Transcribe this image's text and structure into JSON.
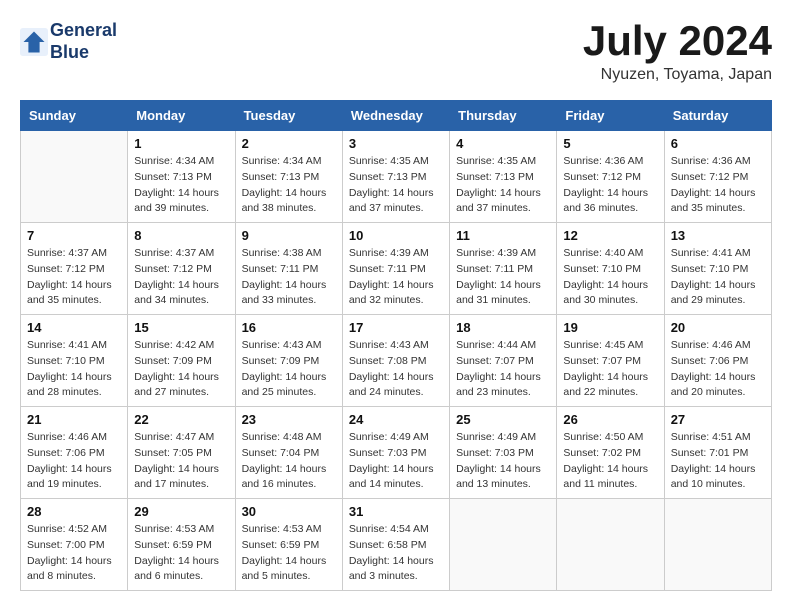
{
  "header": {
    "logo_line1": "General",
    "logo_line2": "Blue",
    "title": "July 2024",
    "location": "Nyuzen, Toyama, Japan"
  },
  "days_of_week": [
    "Sunday",
    "Monday",
    "Tuesday",
    "Wednesday",
    "Thursday",
    "Friday",
    "Saturday"
  ],
  "weeks": [
    [
      {
        "day": "",
        "sunrise": "",
        "sunset": "",
        "daylight": ""
      },
      {
        "day": "1",
        "sunrise": "Sunrise: 4:34 AM",
        "sunset": "Sunset: 7:13 PM",
        "daylight": "Daylight: 14 hours and 39 minutes."
      },
      {
        "day": "2",
        "sunrise": "Sunrise: 4:34 AM",
        "sunset": "Sunset: 7:13 PM",
        "daylight": "Daylight: 14 hours and 38 minutes."
      },
      {
        "day": "3",
        "sunrise": "Sunrise: 4:35 AM",
        "sunset": "Sunset: 7:13 PM",
        "daylight": "Daylight: 14 hours and 37 minutes."
      },
      {
        "day": "4",
        "sunrise": "Sunrise: 4:35 AM",
        "sunset": "Sunset: 7:13 PM",
        "daylight": "Daylight: 14 hours and 37 minutes."
      },
      {
        "day": "5",
        "sunrise": "Sunrise: 4:36 AM",
        "sunset": "Sunset: 7:12 PM",
        "daylight": "Daylight: 14 hours and 36 minutes."
      },
      {
        "day": "6",
        "sunrise": "Sunrise: 4:36 AM",
        "sunset": "Sunset: 7:12 PM",
        "daylight": "Daylight: 14 hours and 35 minutes."
      }
    ],
    [
      {
        "day": "7",
        "sunrise": "Sunrise: 4:37 AM",
        "sunset": "Sunset: 7:12 PM",
        "daylight": "Daylight: 14 hours and 35 minutes."
      },
      {
        "day": "8",
        "sunrise": "Sunrise: 4:37 AM",
        "sunset": "Sunset: 7:12 PM",
        "daylight": "Daylight: 14 hours and 34 minutes."
      },
      {
        "day": "9",
        "sunrise": "Sunrise: 4:38 AM",
        "sunset": "Sunset: 7:11 PM",
        "daylight": "Daylight: 14 hours and 33 minutes."
      },
      {
        "day": "10",
        "sunrise": "Sunrise: 4:39 AM",
        "sunset": "Sunset: 7:11 PM",
        "daylight": "Daylight: 14 hours and 32 minutes."
      },
      {
        "day": "11",
        "sunrise": "Sunrise: 4:39 AM",
        "sunset": "Sunset: 7:11 PM",
        "daylight": "Daylight: 14 hours and 31 minutes."
      },
      {
        "day": "12",
        "sunrise": "Sunrise: 4:40 AM",
        "sunset": "Sunset: 7:10 PM",
        "daylight": "Daylight: 14 hours and 30 minutes."
      },
      {
        "day": "13",
        "sunrise": "Sunrise: 4:41 AM",
        "sunset": "Sunset: 7:10 PM",
        "daylight": "Daylight: 14 hours and 29 minutes."
      }
    ],
    [
      {
        "day": "14",
        "sunrise": "Sunrise: 4:41 AM",
        "sunset": "Sunset: 7:10 PM",
        "daylight": "Daylight: 14 hours and 28 minutes."
      },
      {
        "day": "15",
        "sunrise": "Sunrise: 4:42 AM",
        "sunset": "Sunset: 7:09 PM",
        "daylight": "Daylight: 14 hours and 27 minutes."
      },
      {
        "day": "16",
        "sunrise": "Sunrise: 4:43 AM",
        "sunset": "Sunset: 7:09 PM",
        "daylight": "Daylight: 14 hours and 25 minutes."
      },
      {
        "day": "17",
        "sunrise": "Sunrise: 4:43 AM",
        "sunset": "Sunset: 7:08 PM",
        "daylight": "Daylight: 14 hours and 24 minutes."
      },
      {
        "day": "18",
        "sunrise": "Sunrise: 4:44 AM",
        "sunset": "Sunset: 7:07 PM",
        "daylight": "Daylight: 14 hours and 23 minutes."
      },
      {
        "day": "19",
        "sunrise": "Sunrise: 4:45 AM",
        "sunset": "Sunset: 7:07 PM",
        "daylight": "Daylight: 14 hours and 22 minutes."
      },
      {
        "day": "20",
        "sunrise": "Sunrise: 4:46 AM",
        "sunset": "Sunset: 7:06 PM",
        "daylight": "Daylight: 14 hours and 20 minutes."
      }
    ],
    [
      {
        "day": "21",
        "sunrise": "Sunrise: 4:46 AM",
        "sunset": "Sunset: 7:06 PM",
        "daylight": "Daylight: 14 hours and 19 minutes."
      },
      {
        "day": "22",
        "sunrise": "Sunrise: 4:47 AM",
        "sunset": "Sunset: 7:05 PM",
        "daylight": "Daylight: 14 hours and 17 minutes."
      },
      {
        "day": "23",
        "sunrise": "Sunrise: 4:48 AM",
        "sunset": "Sunset: 7:04 PM",
        "daylight": "Daylight: 14 hours and 16 minutes."
      },
      {
        "day": "24",
        "sunrise": "Sunrise: 4:49 AM",
        "sunset": "Sunset: 7:03 PM",
        "daylight": "Daylight: 14 hours and 14 minutes."
      },
      {
        "day": "25",
        "sunrise": "Sunrise: 4:49 AM",
        "sunset": "Sunset: 7:03 PM",
        "daylight": "Daylight: 14 hours and 13 minutes."
      },
      {
        "day": "26",
        "sunrise": "Sunrise: 4:50 AM",
        "sunset": "Sunset: 7:02 PM",
        "daylight": "Daylight: 14 hours and 11 minutes."
      },
      {
        "day": "27",
        "sunrise": "Sunrise: 4:51 AM",
        "sunset": "Sunset: 7:01 PM",
        "daylight": "Daylight: 14 hours and 10 minutes."
      }
    ],
    [
      {
        "day": "28",
        "sunrise": "Sunrise: 4:52 AM",
        "sunset": "Sunset: 7:00 PM",
        "daylight": "Daylight: 14 hours and 8 minutes."
      },
      {
        "day": "29",
        "sunrise": "Sunrise: 4:53 AM",
        "sunset": "Sunset: 6:59 PM",
        "daylight": "Daylight: 14 hours and 6 minutes."
      },
      {
        "day": "30",
        "sunrise": "Sunrise: 4:53 AM",
        "sunset": "Sunset: 6:59 PM",
        "daylight": "Daylight: 14 hours and 5 minutes."
      },
      {
        "day": "31",
        "sunrise": "Sunrise: 4:54 AM",
        "sunset": "Sunset: 6:58 PM",
        "daylight": "Daylight: 14 hours and 3 minutes."
      },
      {
        "day": "",
        "sunrise": "",
        "sunset": "",
        "daylight": ""
      },
      {
        "day": "",
        "sunrise": "",
        "sunset": "",
        "daylight": ""
      },
      {
        "day": "",
        "sunrise": "",
        "sunset": "",
        "daylight": ""
      }
    ]
  ]
}
